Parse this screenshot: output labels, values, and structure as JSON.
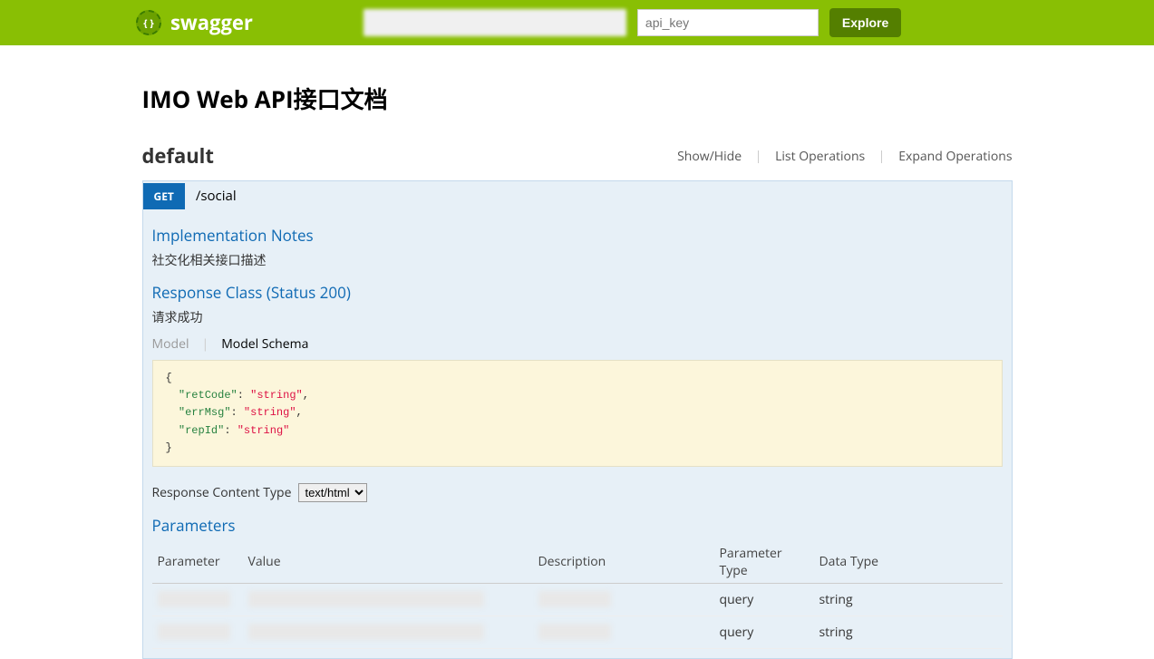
{
  "header": {
    "brand": "swagger",
    "apikey_placeholder": "api_key",
    "explore_label": "Explore"
  },
  "page": {
    "title": "IMO Web API接口文档"
  },
  "resource": {
    "name": "default",
    "actions": {
      "showhide": "Show/Hide",
      "list": "List Operations",
      "expand": "Expand Operations"
    }
  },
  "operation": {
    "method": "GET",
    "path": "/social",
    "impl_heading": "Implementation Notes",
    "impl_notes": "社交化相关接口描述",
    "response_heading": "Response Class (Status 200)",
    "response_desc": "请求成功",
    "model_tab": "Model",
    "schema_tab": "Model Schema",
    "schema": {
      "retCode": "string",
      "errMsg": "string",
      "repId": "string"
    },
    "rct_label": "Response Content Type",
    "rct_value": "text/html",
    "params_heading": "Parameters",
    "params_columns": {
      "parameter": "Parameter",
      "value": "Value",
      "description": "Description",
      "ptype": "Parameter Type",
      "dtype": "Data Type"
    },
    "params": [
      {
        "parameter_type": "query",
        "data_type": "string"
      },
      {
        "parameter_type": "query",
        "data_type": "string"
      }
    ]
  }
}
